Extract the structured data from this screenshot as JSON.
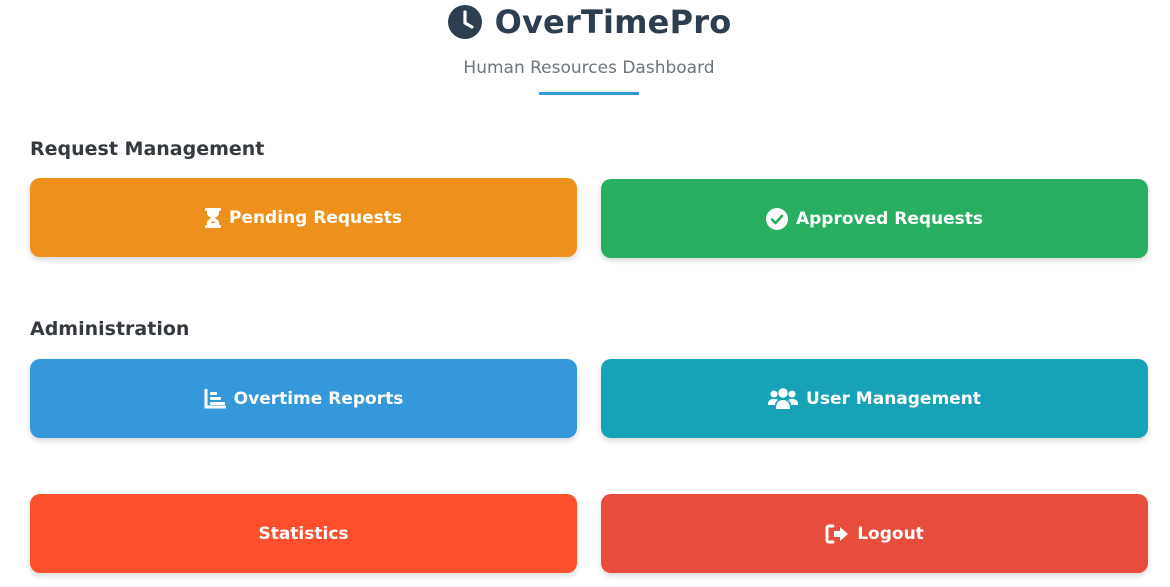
{
  "app": {
    "title": "OverTimePro",
    "subtitle": "Human Resources Dashboard",
    "logo_icon": "clock-icon"
  },
  "colors": {
    "accent": "#3498db",
    "pending": "#ee911c",
    "approved": "#27ae60",
    "reports": "#3498db",
    "users": "#17a2b8",
    "statistics": "#fe4f2c",
    "logout": "#e74c3c"
  },
  "sections": {
    "request_management": "Request Management",
    "administration": "Administration"
  },
  "buttons": {
    "pending": {
      "label": "Pending Requests",
      "icon": "hourglass-icon"
    },
    "approved": {
      "label": "Approved Requests",
      "icon": "check-circle-icon"
    },
    "reports": {
      "label": "Overtime Reports",
      "icon": "chart-icon"
    },
    "users": {
      "label": "User Management",
      "icon": "users-icon"
    },
    "statistics": {
      "label": "Statistics"
    },
    "logout": {
      "label": "Logout",
      "icon": "sign-out-icon"
    }
  }
}
